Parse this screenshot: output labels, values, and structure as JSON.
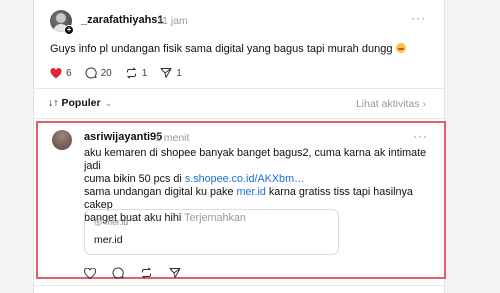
{
  "post": {
    "username": "_zarafathiyahs1",
    "time": "11 jam",
    "more": "···",
    "text": "Guys info pl undangan fisik sama digital yang bagus tapi murah dungg",
    "likes": "6",
    "comments": "20",
    "reposts": "1",
    "shares": "1"
  },
  "sort": {
    "label": "Populer",
    "view_activity": "Lihat aktivitas"
  },
  "reply": {
    "username": "asriwijayanti95",
    "time": "1 menit",
    "more": "···",
    "line1": "aku kemaren di shopee banyak banget bagus2, cuma karna ak intimate jadi",
    "line2_prefix": "cuma bikin 50 pcs di ",
    "line2_link": "s.shopee.co.id/AKXbm…",
    "line3_prefix": "sama undangan digital ku pake ",
    "line3_link": "mer.id",
    "line3_suffix": " karna gratiss tiss tapi hasilnya cakep",
    "line4": "banget buat aku hihi",
    "translate": "Terjemahkan",
    "preview_domain": "mer.id",
    "preview_title": "mer.id"
  },
  "colors": {
    "like_red": "#e0243a",
    "link_blue": "#1a6fd8",
    "highlight_border": "#e2606a"
  }
}
